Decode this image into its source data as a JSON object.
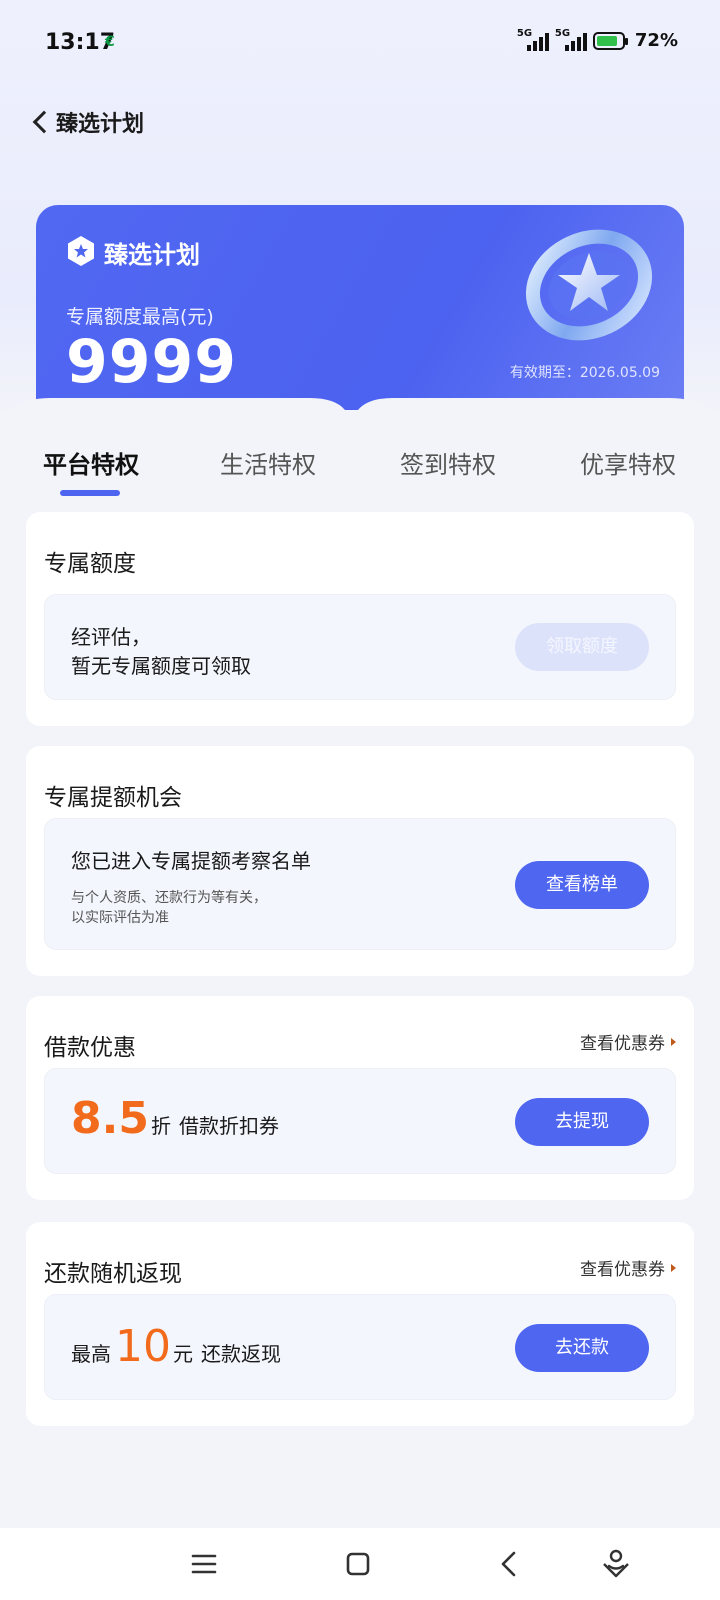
{
  "status_bar": {
    "time": "13:17",
    "signal_1": "5G",
    "signal_2": "5G",
    "battery": "72%"
  },
  "header": {
    "title": "臻选计划"
  },
  "hero": {
    "title": "臻选计划",
    "subtitle": "专属额度最高(元)",
    "amount": "9999",
    "valid_until": "有效期至：2026.05.09"
  },
  "tabs": [
    {
      "label": "平台特权",
      "active": true
    },
    {
      "label": "生活特权",
      "active": false
    },
    {
      "label": "签到特权",
      "active": false
    },
    {
      "label": "优享特权",
      "active": false
    }
  ],
  "quota_card": {
    "title": "专属额度",
    "line1": "经评估，",
    "line2": "暂无专属额度可领取",
    "button": "领取额度"
  },
  "raise_card": {
    "title": "专属提额机会",
    "headline": "您已进入专属提额考察名单",
    "note1": "与个人资质、还款行为等有关，",
    "note2": "以实际评估为准",
    "button": "查看榜单"
  },
  "loan_card": {
    "title": "借款优惠",
    "link": "查看优惠券",
    "discount": "8.5",
    "discount_unit": "折",
    "coupon_label": "借款折扣券",
    "button": "去提现"
  },
  "cashback_card": {
    "title": "还款随机返现",
    "link": "查看优惠券",
    "prefix": "最高",
    "amount": "10",
    "unit": "元",
    "label": "还款返现",
    "button": "去还款"
  },
  "colors": {
    "accent": "#4f66f0",
    "highlight": "#f26a1b"
  },
  "nav_icons": [
    "menu-icon",
    "home-icon",
    "back-icon",
    "assistant-icon"
  ]
}
